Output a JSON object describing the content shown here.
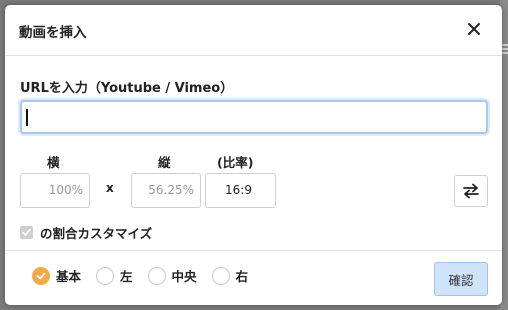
{
  "dialog": {
    "title": "動画を挿入",
    "url_label": "URLを入力（Youtube / Vimeo）",
    "url_value": "",
    "width_label": "横",
    "height_label": "縦",
    "ratio_label": "(比率)",
    "width_value": "100%",
    "height_value": "56.25%",
    "times_sign": "x",
    "ratio_value": "16:9",
    "custom_ratio_label": "の割合カスタマイズ",
    "custom_ratio_checked": true,
    "alignment_options": [
      {
        "label": "基本",
        "selected": true
      },
      {
        "label": "左",
        "selected": false
      },
      {
        "label": "中央",
        "selected": false
      },
      {
        "label": "右",
        "selected": false
      }
    ],
    "confirm_label": "確認"
  },
  "colors": {
    "accent_radio": "#f2a94a",
    "confirm_bg": "#cfe3fb",
    "input_focus": "#a9c8ea"
  },
  "icons": {
    "close": "close-icon",
    "swap": "swap-arrows-icon",
    "check": "check-icon"
  }
}
